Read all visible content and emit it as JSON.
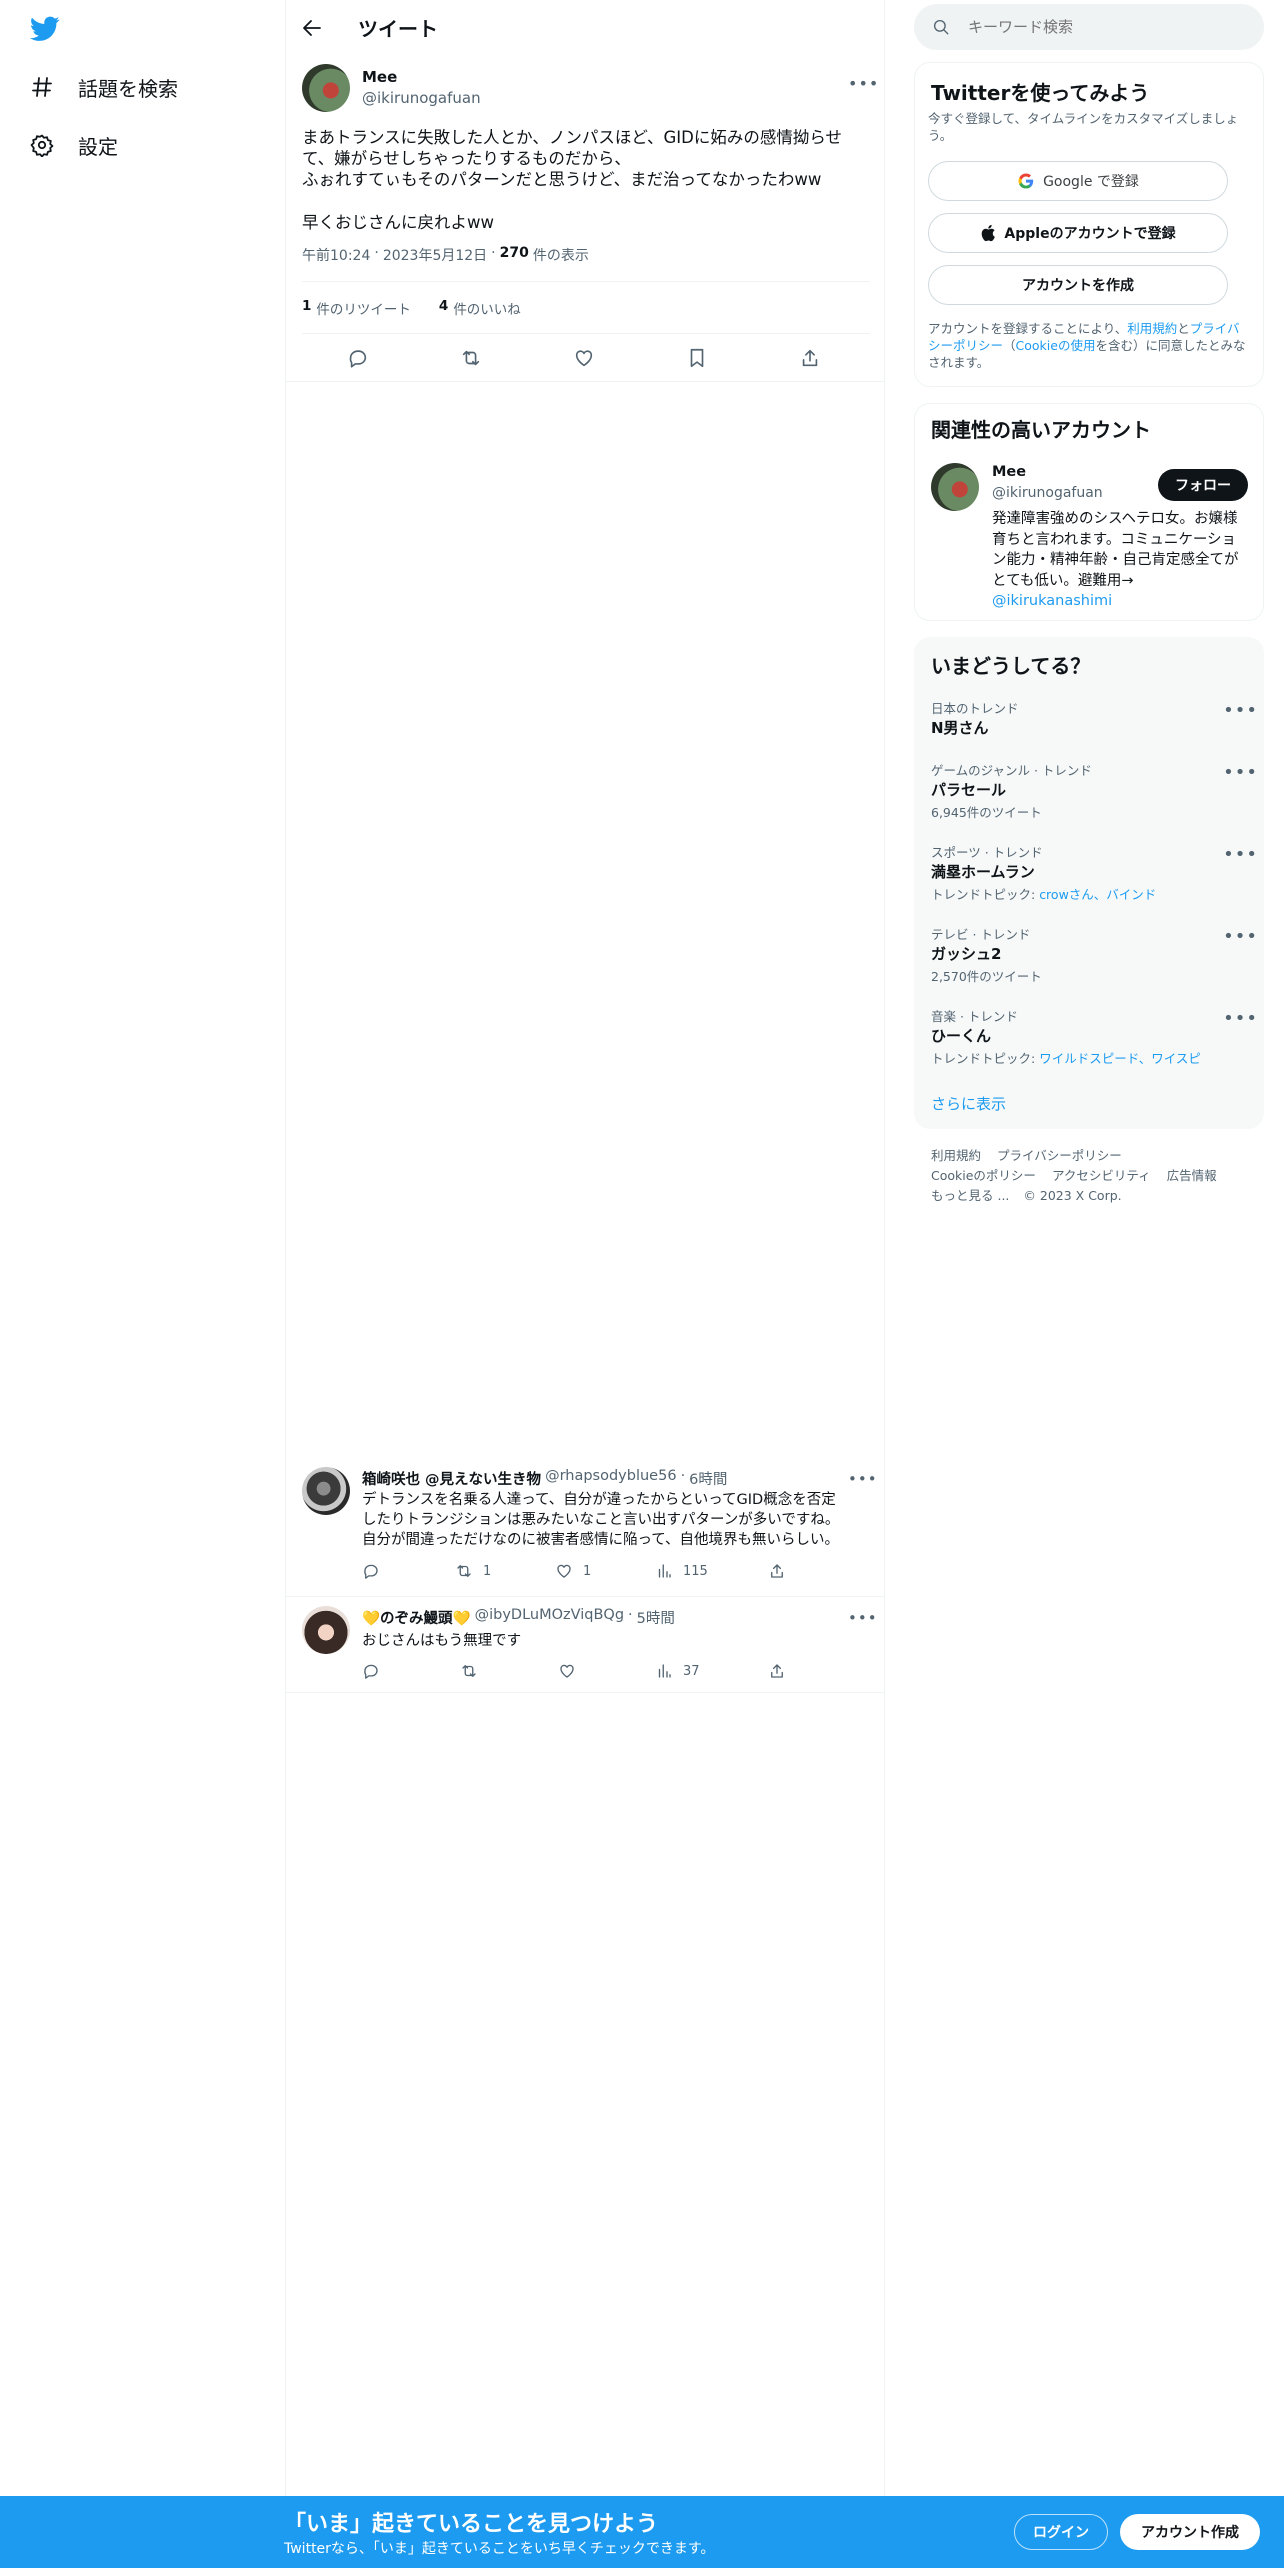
{
  "left_nav": {
    "explore": "話題を検索",
    "settings": "設定"
  },
  "header": {
    "title": "ツイート"
  },
  "tweet": {
    "display_name": "Mee",
    "handle": "@ikirunogafuan",
    "lines": [
      "まあトランスに失敗した人とか、ノンパスほど、GIDに妬みの感情拗らせ",
      "て、嫌がらせしちゃったりするものだから、",
      "ふぉれすてぃもそのパターンだと思うけど、まだ治ってなかったわww"
    ],
    "line2": "早くおじさんに戻れよww",
    "time": "午前10:24",
    "date": "2023年5月12日",
    "views_count": "270",
    "views_label": "件の表示",
    "retweets_count": "1",
    "retweets_label": "件のリツイート",
    "likes_count": "4",
    "likes_label": "件のいいね"
  },
  "replies": [
    {
      "name": "箱崎咲也 @見えない生き物",
      "handle": "@rhapsodyblue56",
      "time": "6時間",
      "lines": [
        "デトランスを名乗る人達って、自分が違ったからといってGID概念を否定",
        "したりトランジションは悪みたいなこと言い出すパターンが多いですね。",
        "自分が間違っただけなのに被害者感情に陥って、自他境界も無いらしい。"
      ],
      "retweets": "1",
      "likes": "1",
      "views": "115"
    },
    {
      "name": "💛のぞみ鰻頭💛",
      "handle": "@ibyDLuMOzViqBQg",
      "time": "5時間",
      "lines": [
        "おじさんはもう無理です"
      ],
      "views": "37"
    }
  ],
  "search": {
    "placeholder": "キーワード検索"
  },
  "signup": {
    "title": "Twitterを使ってみよう",
    "subtitle": "今すぐ登録して、タイムラインをカスタマイズしましょう。",
    "google_btn": "Google で登録",
    "apple_btn": "Appleのアカウントで登録",
    "create_btn": "アカウントを作成",
    "legal_1": "アカウントを登録することにより、",
    "legal_terms": "利用規約",
    "legal_and": "と",
    "legal_privacy": "プライバシーポリシー",
    "legal_paren_open": "（",
    "legal_cookie": "Cookieの使用",
    "legal_2": "を含む）に同意したとみなされます。"
  },
  "related": {
    "title": "関連性の高いアカウント",
    "name": "Mee",
    "handle": "@ikirunogafuan",
    "follow_btn": "フォロー",
    "bio": "発達障害強めのシスヘテロ女。お嬢様育ちと言われます。コミュニケーション能力・精神年齢・自己肯定感全てがとても低い。避難用→",
    "bio_link": "@ikirukanashimi"
  },
  "trends": {
    "title": "いまどうしてる？",
    "items": [
      {
        "context": "日本のトレンド",
        "name": "N男さん",
        "meta": ""
      },
      {
        "context": "ゲームのジャンル · トレンド",
        "name": "パラセール",
        "meta": "6,945件のツイート"
      },
      {
        "context": "スポーツ · トレンド",
        "name": "満塁ホームラン",
        "meta_prefix": "トレンドトピック: ",
        "meta_link": "crowさん、バインド"
      },
      {
        "context": "テレビ · トレンド",
        "name": "ガッシュ2",
        "meta": "2,570件のツイート"
      },
      {
        "context": "音楽 · トレンド",
        "name": "ひーくん",
        "meta_prefix": "トレンドトピック: ",
        "meta_link": "ワイルドスピード、ワイスピ"
      }
    ],
    "show_more": "さらに表示"
  },
  "footer": {
    "terms": "利用規約",
    "privacy": "プライバシーポリシー",
    "cookie": "Cookieのポリシー",
    "accessibility": "アクセシビリティ",
    "ads": "広告情報",
    "more": "もっと見る ...",
    "copyright": "© 2023 X Corp."
  },
  "bottom_bar": {
    "title": "「いま」起きていることを見つけよう",
    "subtitle": "Twitterなら、「いま」起きていることをいち早くチェックできます。",
    "login_btn": "ログイン",
    "signup_btn": "アカウント作成"
  },
  "colors": {
    "brand": "#1d9bf0",
    "text": "#0f1419",
    "muted": "#536471"
  }
}
